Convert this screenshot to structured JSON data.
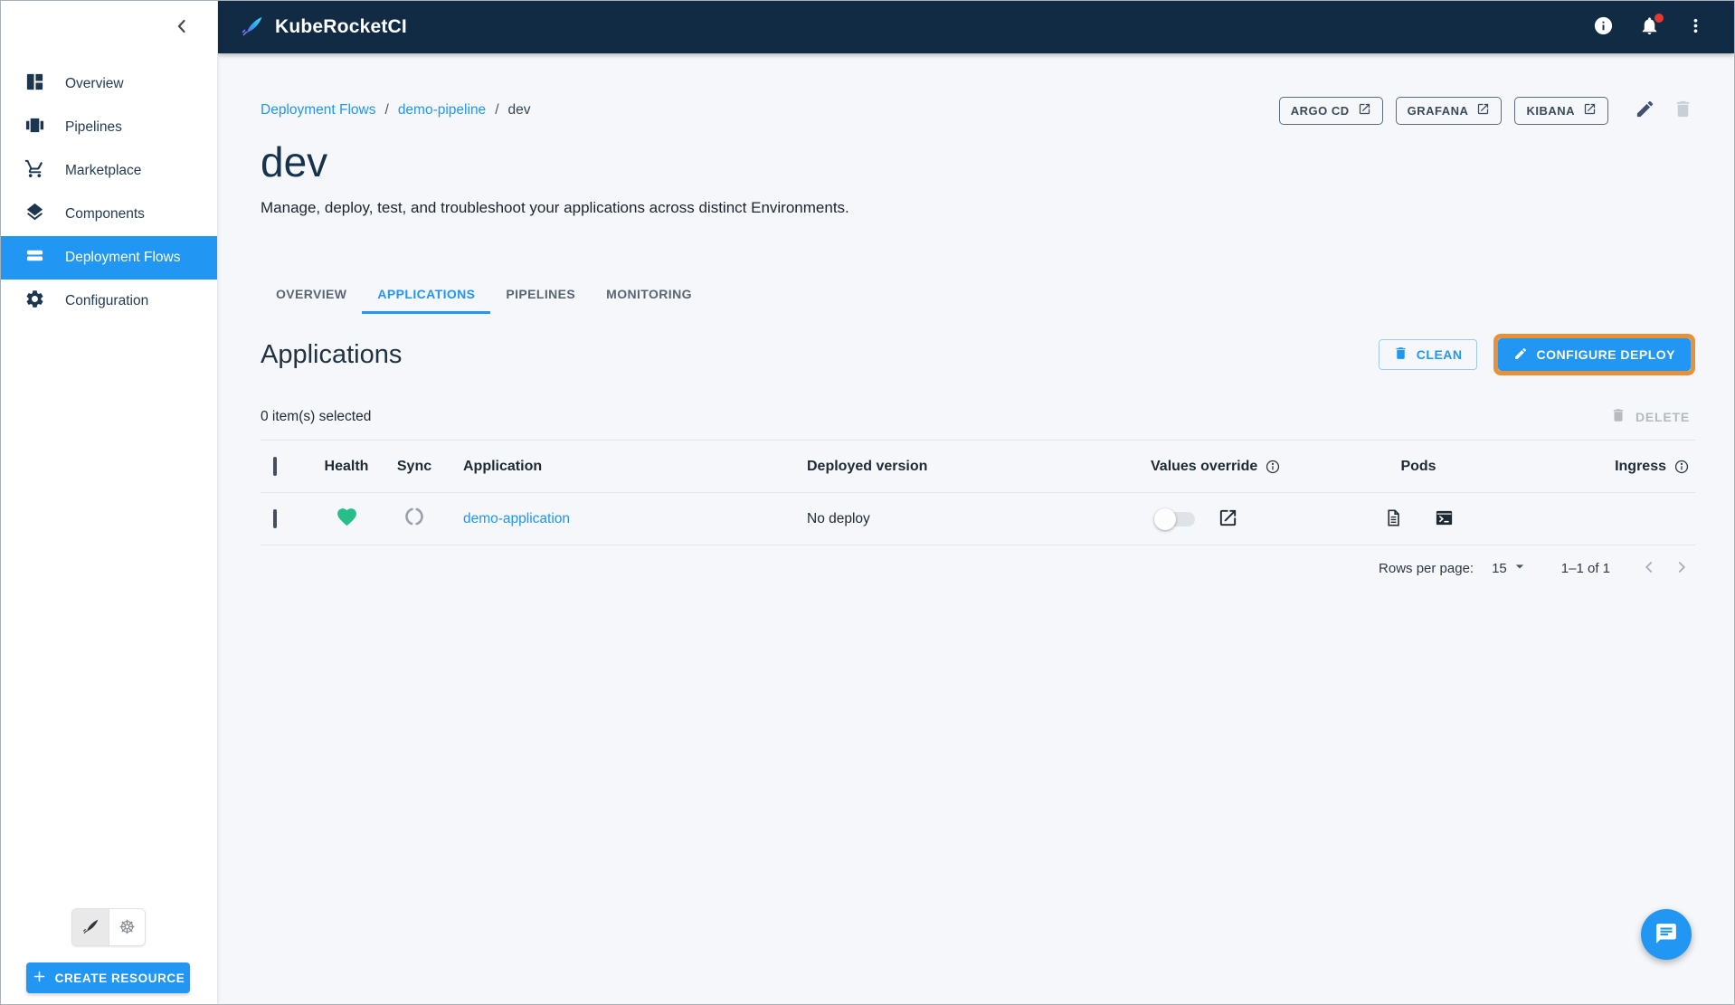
{
  "header": {
    "title": "KubeRocketCI"
  },
  "sidebar": {
    "items": [
      {
        "label": "Overview",
        "icon": "dashboard-icon",
        "active": false
      },
      {
        "label": "Pipelines",
        "icon": "pipelines-icon",
        "active": false
      },
      {
        "label": "Marketplace",
        "icon": "cart-icon",
        "active": false
      },
      {
        "label": "Components",
        "icon": "layers-icon",
        "active": false
      },
      {
        "label": "Deployment Flows",
        "icon": "flows-icon",
        "active": true
      },
      {
        "label": "Configuration",
        "icon": "gear-icon",
        "active": false
      }
    ],
    "create_resource": {
      "label": "CREATE RESOURCE"
    }
  },
  "breadcrumb": {
    "links": [
      {
        "label": "Deployment Flows"
      },
      {
        "label": "demo-pipeline"
      }
    ],
    "current": "dev",
    "separator": "/"
  },
  "quick_links": [
    {
      "label": "ARGO CD"
    },
    {
      "label": "GRAFANA"
    },
    {
      "label": "KIBANA"
    }
  ],
  "page": {
    "title": "dev",
    "description": "Manage, deploy, test, and troubleshoot your applications across distinct Environments."
  },
  "tabs": [
    {
      "label": "OVERVIEW",
      "active": false
    },
    {
      "label": "APPLICATIONS",
      "active": true
    },
    {
      "label": "PIPELINES",
      "active": false
    },
    {
      "label": "MONITORING",
      "active": false
    }
  ],
  "applications": {
    "heading": "Applications",
    "actions": {
      "clean": "CLEAN",
      "configure_deploy": "CONFIGURE DEPLOY"
    },
    "selection": {
      "summary": "0 item(s) selected",
      "delete_label": "DELETE"
    },
    "table": {
      "columns": [
        "Health",
        "Sync",
        "Application",
        "Deployed version",
        "Values override",
        "Pods",
        "Ingress"
      ],
      "rows": [
        {
          "application": "demo-application",
          "deployed_version": "No deploy",
          "health": "healthy",
          "sync": "unknown",
          "values_override_enabled": false
        }
      ]
    },
    "pagination": {
      "label": "Rows per page:",
      "value": "15",
      "range": "1–1 of 1"
    }
  },
  "icons": {
    "logo": "quill-feather",
    "collapse": "chevron-left",
    "info": "info-circle",
    "notifications": "bell-with-red-dot",
    "more": "kebab-dots",
    "external_link": "open-in-new",
    "edit": "pencil",
    "delete": "trash",
    "health_healthy": "green-heart",
    "sync_unknown": "gray-dashed-circle",
    "pod_logs": "document",
    "pod_terminal": "terminal",
    "chat": "chat-bubble",
    "kubernetes": "☸",
    "add": "plus"
  },
  "colors": {
    "accent_blue": "#2196f3",
    "header_navy": "#112b45",
    "highlight_orange": "#e8913a",
    "health_green": "#27be8a",
    "notification_red": "#e53935"
  }
}
